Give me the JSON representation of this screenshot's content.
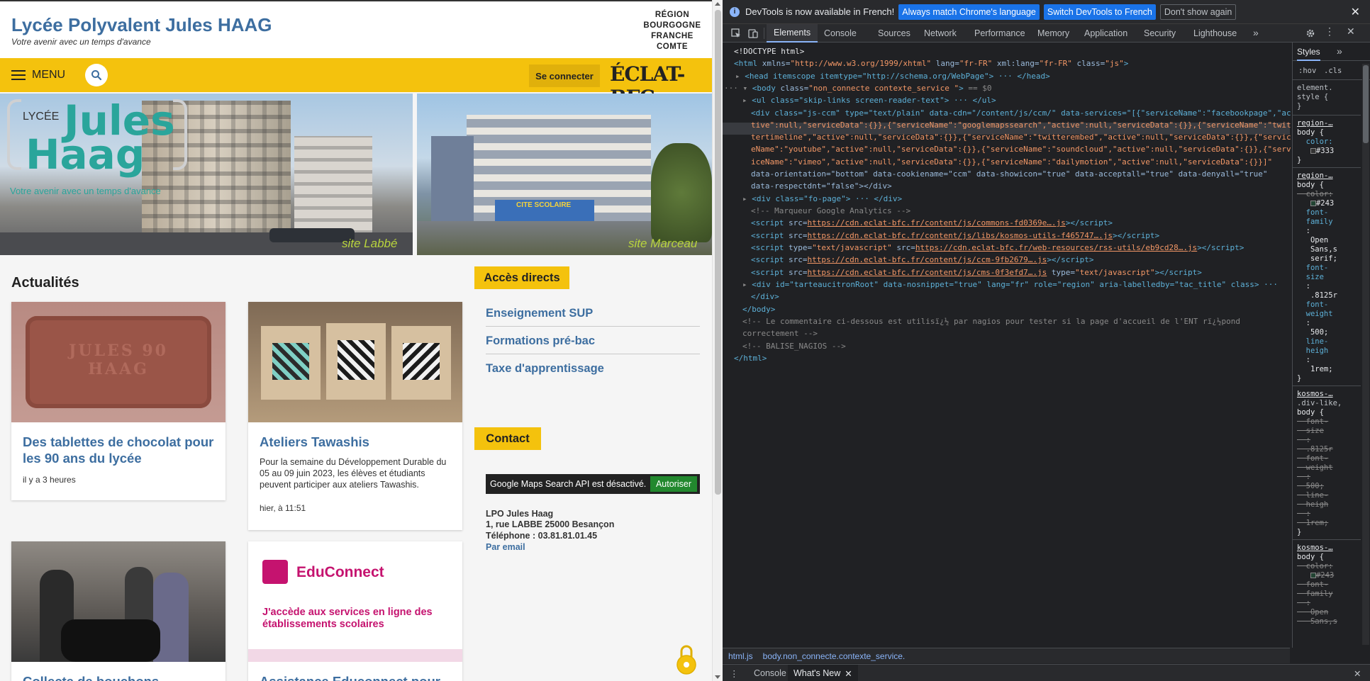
{
  "site": {
    "title": "Lycée Polyvalent Jules HAAG",
    "tagline": "Votre avenir avec un temps d'avance",
    "region_logo": [
      "RÉGION",
      "BOURGOGNE",
      "FRANCHE",
      "COMTE"
    ],
    "menu_label": "MENU",
    "login_label": "Se connecter",
    "eclat_logo": "ÉCLAT-BFC",
    "hero": {
      "lycee_word": "LYCÉE",
      "name_line1": "Jules",
      "name_line2": "Haag",
      "tagline": "Votre avenir avec un temps d'avance",
      "site_left": "site Labbé",
      "site_right": "site Marceau",
      "building_sign": "CITE SCOLAIRE"
    },
    "news_heading": "Actualités",
    "cards": [
      {
        "title": "Des tablettes de chocolat pour les 90 ans du lycée",
        "text": "",
        "time": "il y a 3 heures",
        "image_text": "JULES 90 HAAG"
      },
      {
        "title": "Ateliers Tawashis",
        "text": "Pour la semaine du Développement Durable du 05 au 09 juin 2023, les élèves et étudiants peuvent participer aux ateliers Tawashis.",
        "time": "hier, à 11:51",
        "image_text": ""
      },
      {
        "title": "Collecte de bouchons",
        "text": "",
        "time": "",
        "image_text": ""
      },
      {
        "title": "Assistance Educonnect pour",
        "text": "",
        "time": "",
        "image_text": "EduConnect",
        "image_subtext": "J'accède aux services en ligne des établissements scolaires"
      }
    ],
    "direct_heading": "Accès directs",
    "direct_links": [
      "Enseignement SUP",
      "Formations pré-bac",
      "Taxe d'apprentissage"
    ],
    "contact_heading": "Contact",
    "maps_notice": "Google Maps Search API est désactivé.",
    "maps_button": "Autoriser",
    "contact": {
      "name": "LPO Jules Haag",
      "address": "1, rue LABBE 25000 Besançon",
      "phone": "Téléphone : 03.81.81.01.45",
      "email_link": "Par email"
    }
  },
  "devtools": {
    "info_text": "DevTools is now available in French!",
    "info_btn_match": "Always match Chrome's language",
    "info_btn_switch": "Switch DevTools to French",
    "info_btn_dismiss": "Don't show again",
    "tabs": [
      "Elements",
      "Console",
      "Sources",
      "Network",
      "Performance",
      "Memory",
      "Application",
      "Security",
      "Lighthouse"
    ],
    "active_tab": "Elements",
    "code": {
      "doctype": "<!DOCTYPE html>",
      "html_open_tag": "<html",
      "html_xmlns_attr": " xmlns=",
      "html_xmlns_val": "\"http://www.w3.org/1999/xhtml\"",
      "html_lang_attr": " lang=",
      "html_lang_val": "\"fr-FR\"",
      "html_xmllang_attr": " xml:lang=",
      "html_xmllang_val": "\"fr-FR\"",
      "html_class_attr": " class=",
      "html_class_val": "\"js\"",
      "head_line": "<head itemscope itemtype=\"http://schema.org/WebPage\"> ··· </head>",
      "body_tag": "<body",
      "body_class_attr": " class=",
      "body_class_val": "\"non_connecte contexte_service \"",
      "body_eq": " == $0",
      "ul_line": "<ul class=\"skip-links screen-reader-text\"> ··· </ul>",
      "div_ccm_1": "<div class=\"js-ccm\" type=\"text/plain\" data-cdn=\"/content/js/ccm/\" data-services=\"[{\"serviceName\":\"facebookpage\",\"ac",
      "div_ccm_2": "tive\":null,\"serviceData\":{}},{\"serviceName\":\"googlemapssearch\",\"active\":null,\"serviceData\":{}},{\"serviceName\":\"twit",
      "div_ccm_3": "tertimeline\",\"active\":null,\"serviceData\":{}},{\"serviceName\":\"twitterembed\",\"active\":null,\"serviceData\":{}},{\"servic",
      "div_ccm_4": "eName\":\"youtube\",\"active\":null,\"serviceData\":{}},{\"serviceName\":\"soundcloud\",\"active\":null,\"serviceData\":{}},{\"serv",
      "div_ccm_5": "iceName\":\"vimeo\",\"active\":null,\"serviceData\":{}},{\"serviceName\":\"dailymotion\",\"active\":null,\"serviceData\":{}}]\"",
      "div_ccm_6": "data-orientation=\"bottom\" data-cookiename=\"ccm\" data-showicon=\"true\" data-acceptall=\"true\" data-denyall=\"true\"",
      "div_ccm_7": "data-respectdnt=\"false\"></div>",
      "fo_page": "<div class=\"fo-page\"> ··· </div>",
      "comment_ga": "<!-- Marqueur Google Analytics -->",
      "script1": "https://cdn.eclat-bfc.fr/content/js/commons-fd0369e….js",
      "script2": "https://cdn.eclat-bfc.fr/content/js/libs/kosmos-utils-f465747….js",
      "script3": "https://cdn.eclat-bfc.fr/web-resources/rss-utils/eb9cd28….js",
      "script4": "https://cdn.eclat-bfc.fr/content/js/ccm-9fb2679….js",
      "script5": "https://cdn.eclat-bfc.fr/content/js/cms-0f3efd7….js",
      "tarteau": "<div id=\"tarteaucitronRoot\" data-nosnippet=\"true\" lang=\"fr\" role=\"region\" aria-labelledby=\"tac_title\" class> ··· ",
      "div_close": "</div>",
      "body_close": "</body>",
      "comment_nagios_1": "<!-- Le commentaire ci-dessous est utilisï¿½ par nagios pour tester si la page d'accueil de l'ENT rï¿½pond",
      "comment_nagios_2": "correctement -->",
      "comment_balise": "<!-- BALISE_NAGIOS -->",
      "html_close": "</html>"
    },
    "styles": {
      "tab": "Styles",
      "filter_hov": ":hov",
      "filter_cls": ".cls",
      "element_style": "element.\nstyle {\n}",
      "rule1_sel": "region-…",
      "rule2_sel": "region-…",
      "rule3_sel": "kosmos-…",
      "rule4_sel": "kosmos-…"
    },
    "breadcrumbs": [
      "html.js",
      "body.non_connecte.contexte_service."
    ],
    "drawer_tabs": [
      "Console",
      "What's New"
    ],
    "active_drawer": "What's New"
  }
}
